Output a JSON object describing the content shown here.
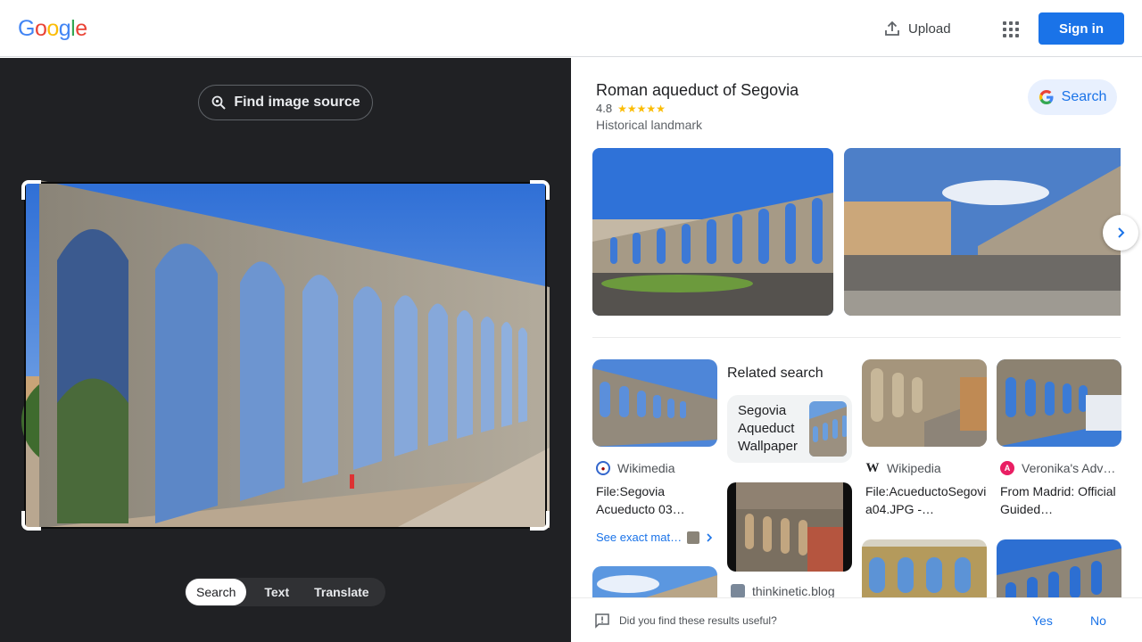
{
  "header": {
    "logo_letters": [
      "G",
      "o",
      "o",
      "g",
      "l",
      "e"
    ],
    "logo_colors": [
      "#4285f4",
      "#ea4335",
      "#fbbc05",
      "#4285f4",
      "#34a853",
      "#ea4335"
    ],
    "upload_label": "Upload",
    "signin_label": "Sign in"
  },
  "left": {
    "find_source_label": "Find image source",
    "tabs": [
      {
        "label": "Search",
        "active": true
      },
      {
        "label": "Text",
        "active": false
      },
      {
        "label": "Translate",
        "active": false
      }
    ]
  },
  "entity": {
    "title": "Roman aqueduct of Segovia",
    "rating": "4.8",
    "stars": "★★★★★",
    "type": "Historical landmark",
    "search_label": "Search"
  },
  "results": {
    "related_label": "Related search",
    "related_query": "Segovia Aqueduct Wallpaper",
    "cards": [
      {
        "source": "Wikimedia",
        "title": "File:Segovia Acueducto 03…"
      },
      {
        "source": "Wikipedia",
        "title": "File:AcueductoSegovia04.JPG -…"
      },
      {
        "source": "Veronika's Adv…",
        "title": "From Madrid: Official Guided…"
      }
    ],
    "exact_match_label": "See exact mat…",
    "think_source": "thinkinetic.blog"
  },
  "feedback": {
    "question": "Did you find these results useful?",
    "yes": "Yes",
    "no": "No"
  },
  "colors": {
    "accent": "#1a73e8",
    "dark_panel": "#202124",
    "star": "#fbbc04"
  }
}
